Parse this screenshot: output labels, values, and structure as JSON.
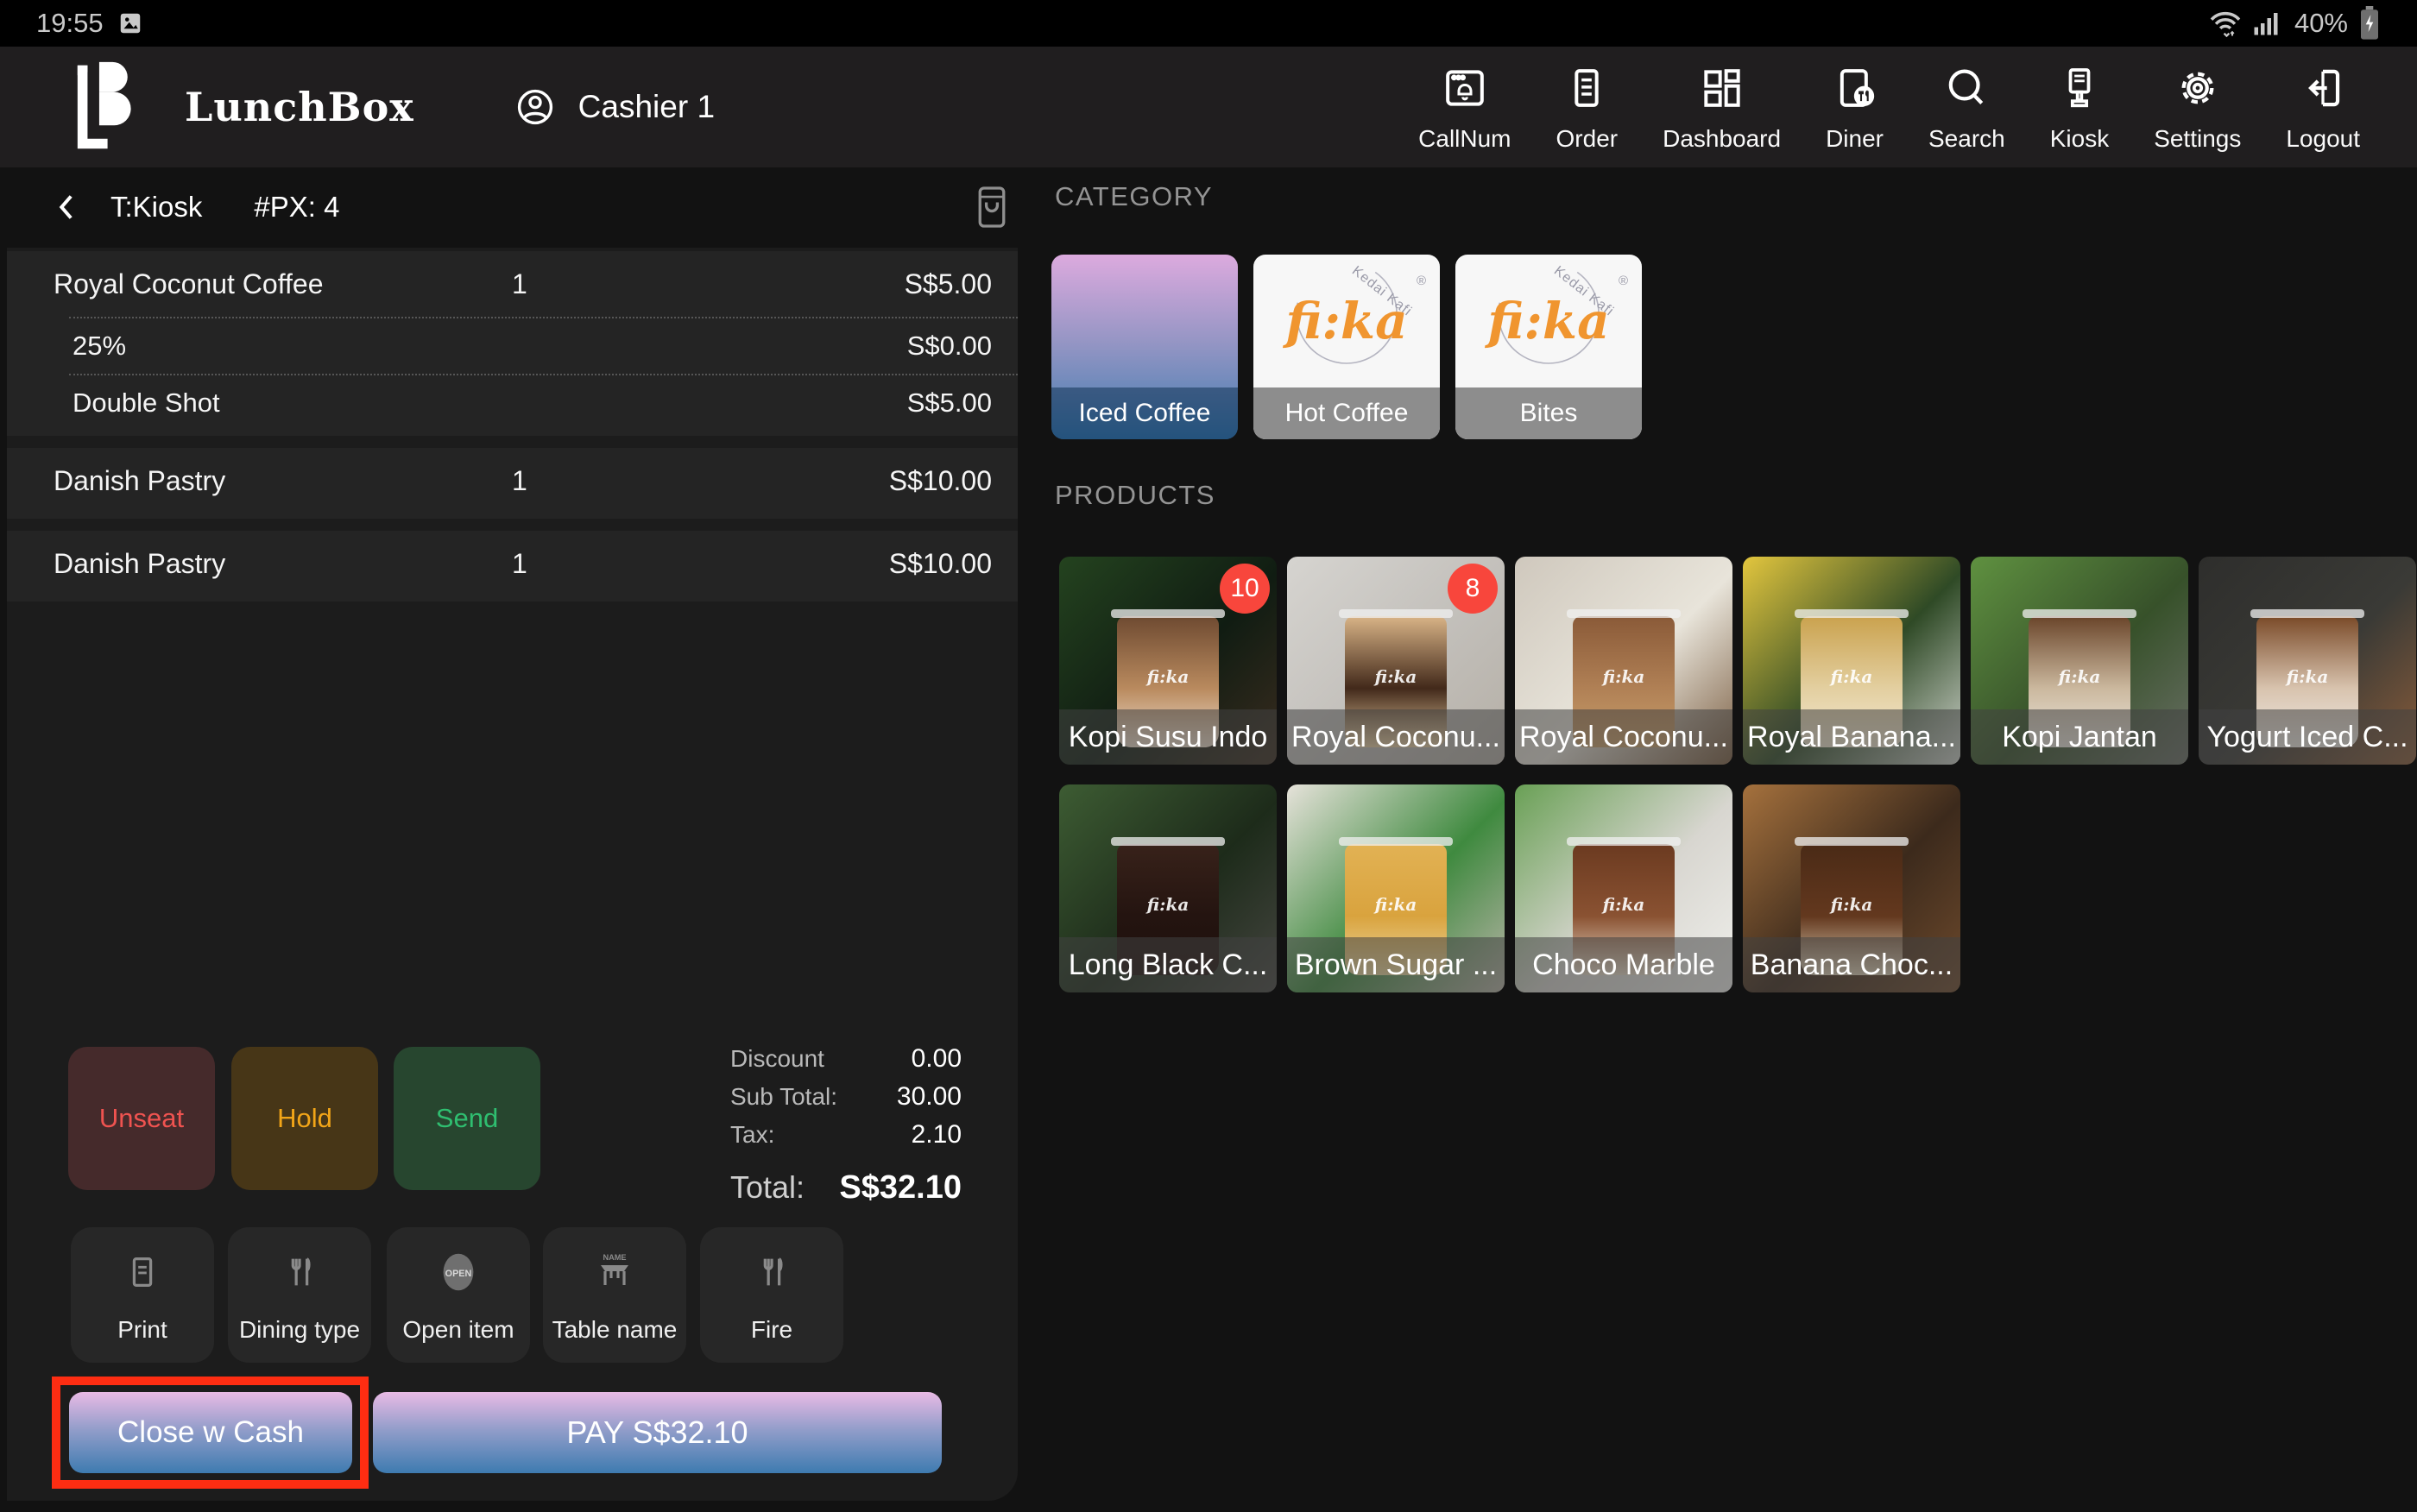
{
  "status_bar": {
    "time": "19:55",
    "battery": "40%"
  },
  "navbar": {
    "brand": "LunchBox",
    "cashier": "Cashier 1",
    "items": [
      {
        "label": "CallNum",
        "icon": "callnum-icon"
      },
      {
        "label": "Order",
        "icon": "order-icon"
      },
      {
        "label": "Dashboard",
        "icon": "dashboard-icon"
      },
      {
        "label": "Diner",
        "icon": "diner-icon"
      },
      {
        "label": "Search",
        "icon": "search-icon"
      },
      {
        "label": "Kiosk",
        "icon": "kiosk-icon"
      },
      {
        "label": "Settings",
        "icon": "gear-icon"
      },
      {
        "label": "Logout",
        "icon": "logout-icon"
      }
    ]
  },
  "order_panel": {
    "table": "T:Kiosk",
    "pax": "#PX: 4",
    "groups": [
      {
        "rows": [
          {
            "name": "Royal Coconut Coffee",
            "qty": "1",
            "price": "S$5.00"
          },
          {
            "name": "25%",
            "price": "S$0.00",
            "sub": true
          },
          {
            "name": "Double Shot",
            "price": "S$5.00",
            "sub": true
          }
        ]
      },
      {
        "rows": [
          {
            "name": "Danish Pastry",
            "qty": "1",
            "price": "S$10.00"
          }
        ]
      },
      {
        "rows": [
          {
            "name": "Danish Pastry",
            "qty": "1",
            "price": "S$10.00"
          }
        ]
      }
    ],
    "actions": [
      {
        "label": "Unseat",
        "fg": "#ef5350",
        "bg": "#452a2b"
      },
      {
        "label": "Hold",
        "fg": "#f2a518",
        "bg": "#473617"
      },
      {
        "label": "Send",
        "fg": "#2fbe70",
        "bg": "#27462f"
      }
    ],
    "totals": {
      "discount_label": "Discount",
      "discount": "0.00",
      "subtotal_label": "Sub Total:",
      "subtotal": "30.00",
      "tax_label": "Tax:",
      "tax": "2.10",
      "total_label": "Total:",
      "total": "S$32.10"
    },
    "tools": [
      {
        "label": "Print",
        "icon": "print-icon"
      },
      {
        "label": "Dining type",
        "icon": "dining-type-icon"
      },
      {
        "label": "Open item",
        "icon": "open-item-icon"
      },
      {
        "label": "Table name",
        "icon": "table-name-icon"
      },
      {
        "label": "Fire",
        "icon": "fire-icon"
      }
    ],
    "close_cash_label": "Close w Cash",
    "pay_label": "PAY S$32.10",
    "highlight_color": "#fe2d12"
  },
  "catalog": {
    "category_label": "CATEGORY",
    "categories": [
      {
        "name": "Iced Coffee",
        "selected": true
      },
      {
        "name": "Hot Coffee"
      },
      {
        "name": "Bites"
      }
    ],
    "products_label": "PRODUCTS",
    "logo": {
      "text": "fi:ka",
      "arc_text": "Kedai Kafi",
      "reg": "®",
      "color": "#f0952f"
    },
    "products": [
      {
        "name": "Kopi Susu Indo",
        "badge": "10",
        "scene": [
          "#24431f",
          "#101c12",
          "#3a2c1f"
        ],
        "cup": [
          "#6e4a31",
          "#b98a5e",
          "#efe0cf"
        ]
      },
      {
        "name": "Royal Coconu...",
        "badge": "8",
        "scene": [
          "#d6d4d0",
          "#c2bfba",
          "#b5afa6"
        ],
        "cup": [
          "#d9b487",
          "#42291a",
          "#e9cfa4"
        ]
      },
      {
        "name": "Royal Coconu...",
        "scene": [
          "#cfc8bd",
          "#e8e4da",
          "#7a5d41"
        ],
        "cup": [
          "#8a5a38",
          "#b08055",
          "#caa06c"
        ]
      },
      {
        "name": "Royal Banana...",
        "scene": [
          "#e3c63e",
          "#2f4a26",
          "#cfd3cc"
        ],
        "cup": [
          "#caa24e",
          "#e3cfa0",
          "#f2e8d2"
        ]
      },
      {
        "name": "Kopi Jantan",
        "scene": [
          "#5f9140",
          "#37512a",
          "#6a6f66"
        ],
        "cup": [
          "#6a452a",
          "#cbb89e",
          "#ece8df"
        ]
      },
      {
        "name": "Yogurt Iced C...",
        "scene": [
          "#2e2e2c",
          "#3a3a36",
          "#8a5c39"
        ],
        "cup": [
          "#7a4a28",
          "#d8c3ae",
          "#f0ece6"
        ]
      },
      {
        "name": "Long Black C...",
        "scene": [
          "#3d5c33",
          "#1d2b1a",
          "#454540"
        ],
        "cup": [
          "#38221a",
          "#241410",
          "#1d100c"
        ]
      },
      {
        "name": "Brown Sugar ...",
        "scene": [
          "#e6e2da",
          "#3f8a3f",
          "#b9b4a8"
        ],
        "cup": [
          "#e2b254",
          "#d9a33e",
          "#ecd9a0"
        ]
      },
      {
        "name": "Choco Marble",
        "scene": [
          "#69a055",
          "#d8d6d0",
          "#efefeb"
        ],
        "cup": [
          "#6b3a20",
          "#8a5232",
          "#e8dcc9"
        ]
      },
      {
        "name": "Banana Choc...",
        "scene": [
          "#a5713d",
          "#3c2a1c",
          "#6e4a2c"
        ],
        "cup": [
          "#4a2a16",
          "#63381e",
          "#dfd2b8"
        ]
      }
    ]
  }
}
